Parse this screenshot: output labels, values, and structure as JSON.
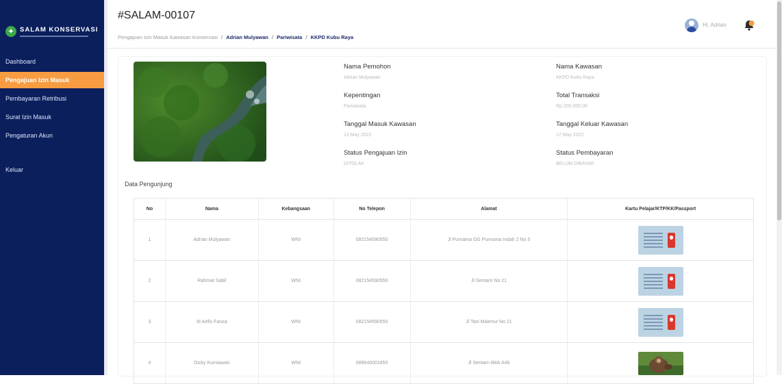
{
  "app": {
    "logo_text": "SALAM KONSERVASI",
    "colors": {
      "sidebar": "#0a1f5c",
      "active": "#f89c41",
      "logo_badge": "#3aa84a"
    }
  },
  "sidebar": {
    "items": [
      {
        "label": "Dashboard",
        "active": false
      },
      {
        "label": "Pengajuan Izin Masuk",
        "active": true
      },
      {
        "label": "Pembayaran Retribusi",
        "active": false
      },
      {
        "label": "Surat Izin Masuk",
        "active": false
      },
      {
        "label": "Pengaturan Akun",
        "active": false
      },
      {
        "label": "Keluar",
        "active": false
      }
    ]
  },
  "header": {
    "title": "#SALAM-00107",
    "breadcrumb": {
      "root": "Pengajuan Izin Masuk Kawasan Konservasi",
      "parts": [
        "Adrian Mulyawan",
        "Pariwisata",
        "KKPD Kubu Raya"
      ]
    },
    "user_greeting": "Hi, Adrian",
    "icons": {
      "avatar": "user-avatar-icon",
      "notification": "bell-icon"
    }
  },
  "detail": {
    "left": [
      {
        "label": "Nama Pemohon",
        "value": "Adrian Mulyawan"
      },
      {
        "label": "Kepentingan",
        "value": "Pariwisata"
      },
      {
        "label": "Tanggal Masuk Kawasan",
        "value": "13 May 2022"
      },
      {
        "label": "Status Pengajuan Izin",
        "value": "DITOLAK"
      }
    ],
    "right": [
      {
        "label": "Nama Kawasan",
        "value": "KKPD Kubu Raya"
      },
      {
        "label": "Total Transaksi",
        "value": "Rp 200.000,00"
      },
      {
        "label": "Tanggal Keluar Kawasan",
        "value": "17 May 2022"
      },
      {
        "label": "Status Pembayaran",
        "value": "BELUM DIBAYAR"
      }
    ]
  },
  "visitors": {
    "title": "Data Pengunjung",
    "columns": [
      "No",
      "Nama",
      "Kebangsaan",
      "No Telepon",
      "Alamat",
      "Kartu Pelajar/KTP/KK/Passport"
    ],
    "rows": [
      {
        "no": "1",
        "nama": "Adrian Mulyawan",
        "kebangsaan": "WNI",
        "telepon": "082154590550",
        "alamat": "Jl Purnama GG Purnama Indah 2 No 5",
        "doc": "id-card"
      },
      {
        "no": "2",
        "nama": "Rahmat Sabil",
        "kebangsaan": "WNI",
        "telepon": "082154590550",
        "alamat": "Jl Sentarn No 21",
        "doc": "id-card"
      },
      {
        "no": "3",
        "nama": "M Aefis Fanza",
        "kebangsaan": "WNI",
        "telepon": "082154590550",
        "alamat": "Jl Tani Makmur No 21",
        "doc": "id-card"
      },
      {
        "no": "4",
        "nama": "Dicky Kurniawan",
        "kebangsaan": "WNI",
        "telepon": "089640001855",
        "alamat": "Jl Sentarn Blok A46",
        "doc": "animal-photo"
      }
    ]
  }
}
